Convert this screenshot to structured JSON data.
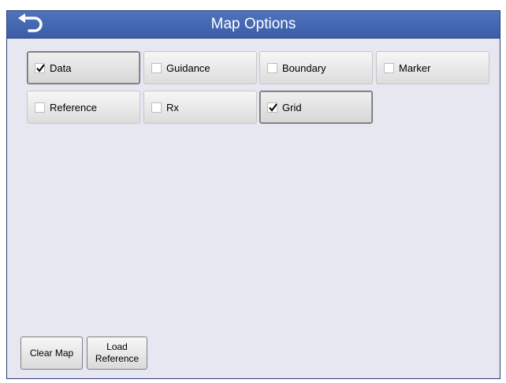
{
  "window": {
    "title": "Map Options",
    "back_icon": "back-arrow-icon"
  },
  "layers": [
    {
      "label": "Data",
      "checked": true
    },
    {
      "label": "Guidance",
      "checked": false
    },
    {
      "label": "Boundary",
      "checked": false
    },
    {
      "label": "Marker",
      "checked": false
    },
    {
      "label": "Reference",
      "checked": false
    },
    {
      "label": "Rx",
      "checked": false
    },
    {
      "label": "Grid",
      "checked": true
    }
  ],
  "actions": {
    "clear_map": "Clear Map",
    "load_reference": "Load\nReference"
  },
  "colors": {
    "titlebar": "#4468b4",
    "background": "#e6e7f0"
  }
}
